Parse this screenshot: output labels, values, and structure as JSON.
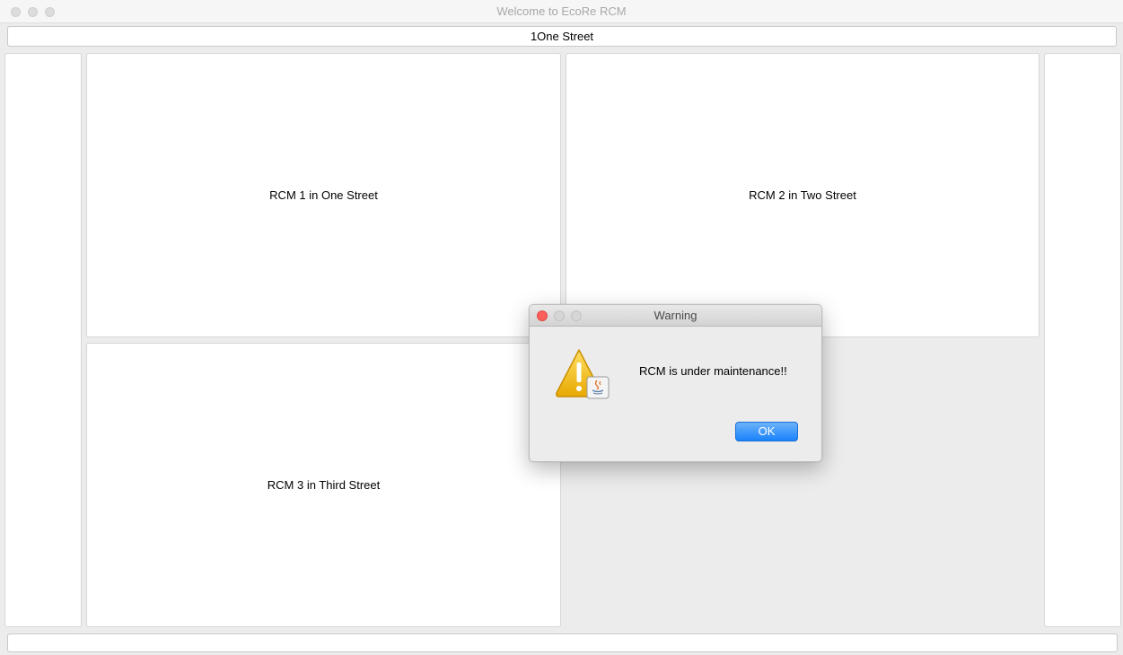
{
  "window": {
    "title": "Welcome to EcoRe RCM"
  },
  "address_bar": {
    "value": "1One Street"
  },
  "rcm_panels": [
    {
      "label": "RCM 1 in One Street"
    },
    {
      "label": "RCM 2 in Two Street"
    },
    {
      "label": "RCM 3 in Third Street"
    }
  ],
  "dialog": {
    "title": "Warning",
    "message": "RCM is under maintenance!!",
    "ok_label": "OK",
    "icon": "warning-icon"
  },
  "colors": {
    "close_red": "#fc605c",
    "ok_blue": "#1a82fb",
    "warning_yellow": "#f5c518"
  }
}
